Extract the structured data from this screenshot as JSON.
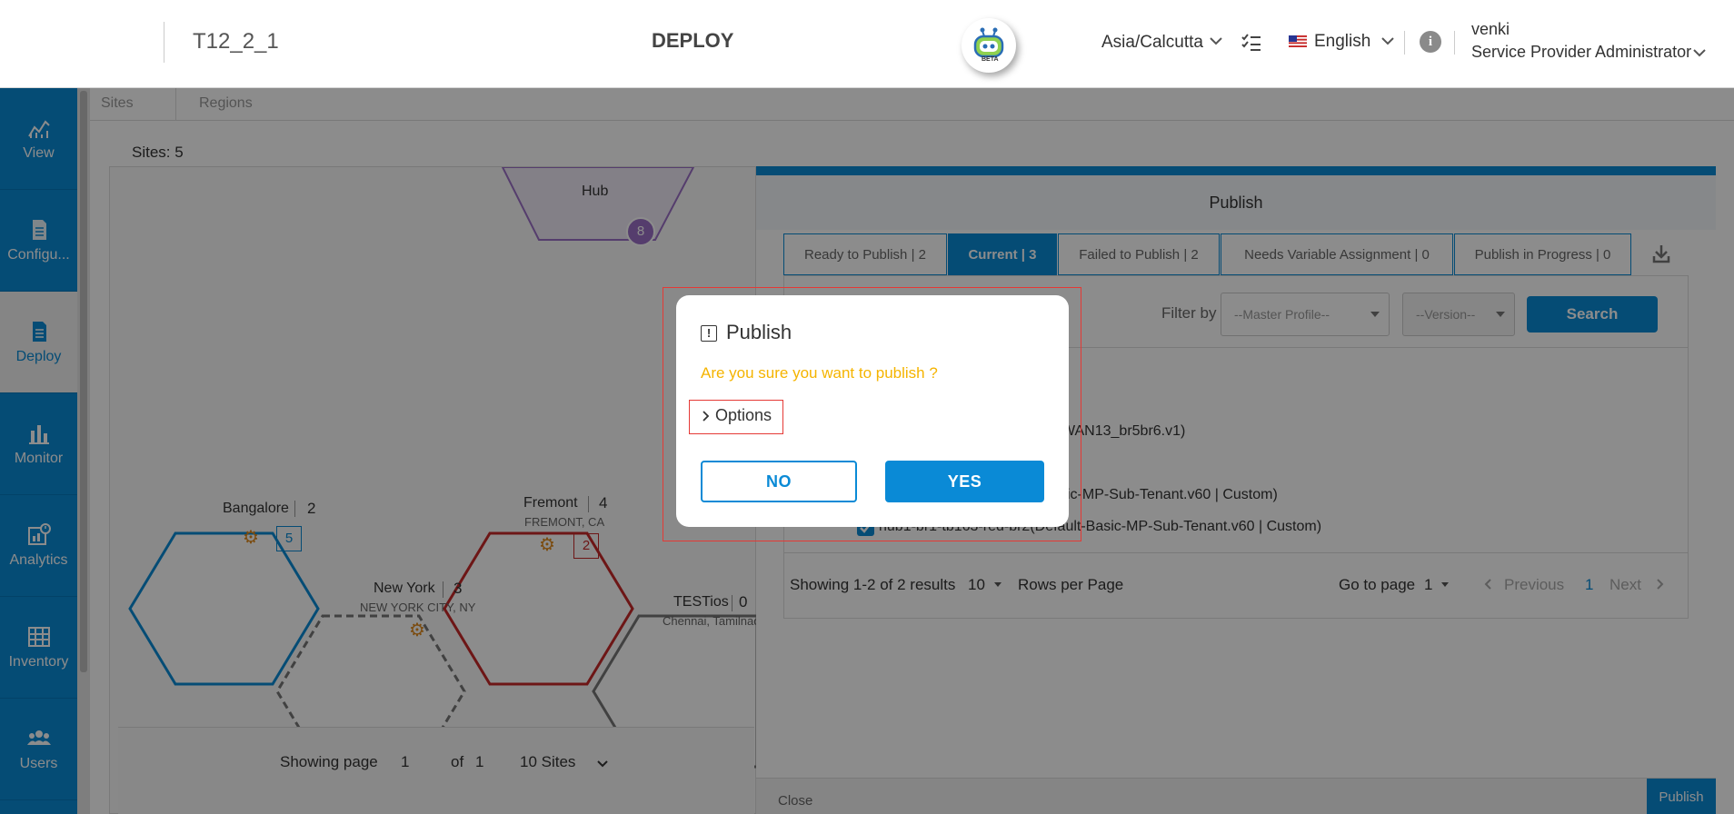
{
  "header": {
    "project_name": "T12_2_1",
    "page_title": "DEPLOY",
    "beta_badge": "BETA",
    "timezone": "Asia/Calcutta",
    "language": "English",
    "user_name": "venki",
    "user_role": "Service Provider Administrator"
  },
  "sidebar": {
    "items": [
      {
        "label": "View",
        "icon": "chart-icon"
      },
      {
        "label": "Configu...",
        "icon": "document-icon"
      },
      {
        "label": "Deploy",
        "icon": "document-icon",
        "active": true
      },
      {
        "label": "Monitor",
        "icon": "bar-chart-icon"
      },
      {
        "label": "Analytics",
        "icon": "analytics-icon"
      },
      {
        "label": "Inventory",
        "icon": "inventory-icon"
      },
      {
        "label": "Users",
        "icon": "users-icon"
      }
    ]
  },
  "content": {
    "tabs": [
      "Sites",
      "Regions"
    ],
    "sites_count": "Sites: 5"
  },
  "map": {
    "hub": {
      "label": "Hub",
      "count": "8"
    },
    "sites": [
      {
        "name": "Bangalore",
        "count": "2",
        "location": "",
        "badge": "5"
      },
      {
        "name": "New York",
        "count": "3",
        "location": "NEW YORK CITY, NY",
        "badge": ""
      },
      {
        "name": "Fremont",
        "count": "4",
        "location": "FREMONT, CA",
        "badge": "2"
      },
      {
        "name": "TESTios",
        "count": "0",
        "location": "Chennai, Tamilnad"
      }
    ],
    "pagination": {
      "showing": "Showing page",
      "page": "1",
      "of": "of",
      "total": "1",
      "per_page": "10 Sites"
    }
  },
  "publish_panel": {
    "title": "Publish",
    "tabs": [
      {
        "label": "Ready to Publish | 2"
      },
      {
        "label": "Current | 3",
        "active": true
      },
      {
        "label": "Failed to Publish | 2"
      },
      {
        "label": "Needs Variable Assignment | 0"
      },
      {
        "label": "Publish in Progress | 0"
      }
    ],
    "filter_label": "Filter by",
    "master_profile_placeholder": "--Master Profile--",
    "version_placeholder": "--Version--",
    "search_button": "Search",
    "rows": [
      "WAN13_br5br6.v1)",
      "sic-MP-Sub-Tenant.v60 | Custom)",
      "hub1-br1-tb163-red-br2(Default-Basic-MP-Sub-Tenant.v60 | Custom)"
    ],
    "pagination": {
      "showing": "Showing 1-2 of 2 results",
      "rows_value": "10",
      "rows_label": "Rows per Page",
      "goto_label": "Go to page",
      "goto_value": "1",
      "previous": "Previous",
      "current_page": "1",
      "next": "Next"
    },
    "close_button": "Close",
    "publish_button": "Publish"
  },
  "dialog": {
    "title": "Publish",
    "message": "Are you sure you want to publish ?",
    "options_label": "Options",
    "no_button": "NO",
    "yes_button": "YES"
  },
  "colors": {
    "accent": "#0a8ad6",
    "warning_text": "#f5b400",
    "highlight": "#e53935",
    "hub_purple": "#9b6fc6"
  }
}
